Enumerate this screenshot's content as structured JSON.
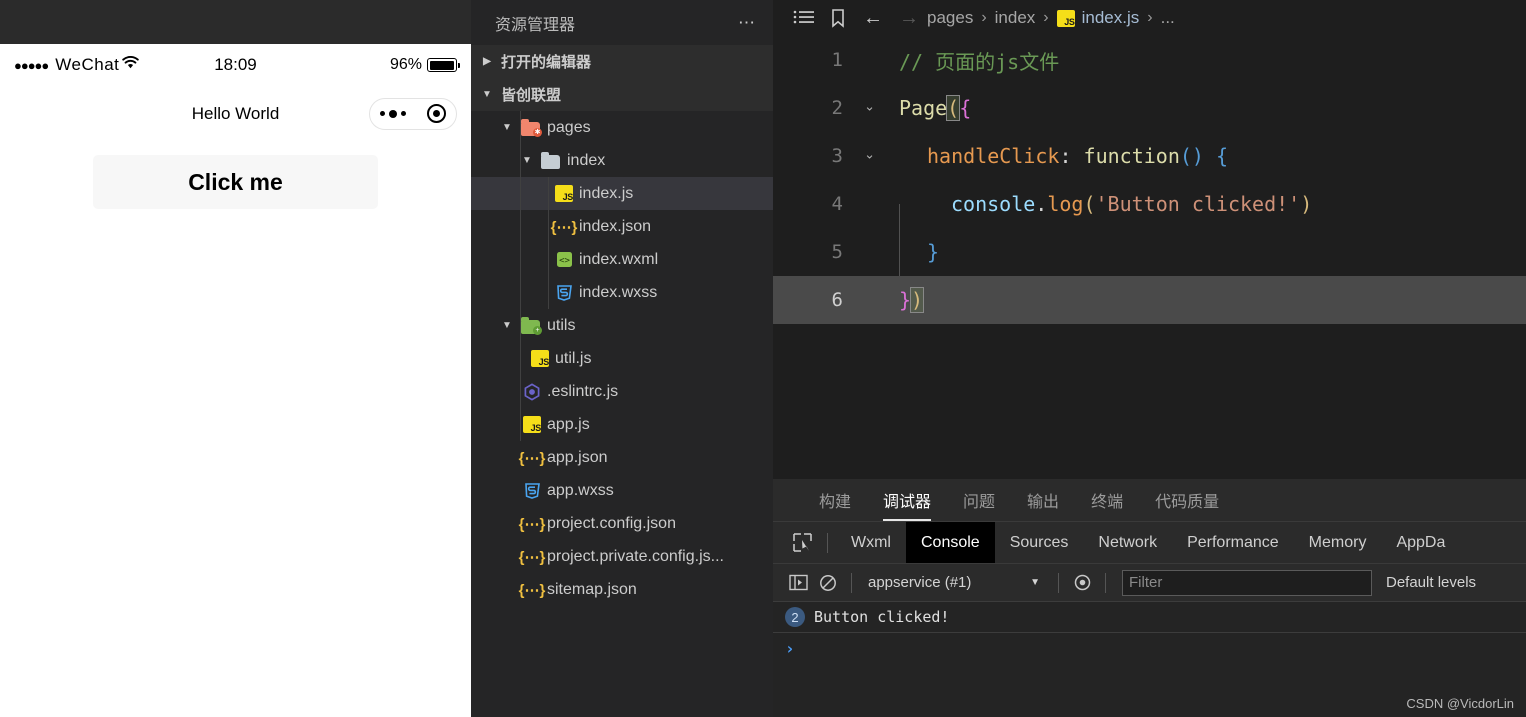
{
  "simulator": {
    "status_bar": {
      "signal_dots": "●●●●●",
      "carrier": "WeChat",
      "wifi_icon": "wifi-icon",
      "time": "18:09",
      "battery_percent": "96%"
    },
    "nav": {
      "title": "Hello World",
      "capsule_more_icon": "more-dots-icon",
      "capsule_target_icon": "target-icon"
    },
    "button_label": "Click me"
  },
  "explorer": {
    "title": "资源管理器",
    "more_icon": "more-actions-icon",
    "sections": [
      {
        "label": "打开的编辑器",
        "expanded": false
      },
      {
        "label": "皆创联盟",
        "expanded": true
      }
    ],
    "tree": [
      {
        "label": "pages",
        "type": "folder",
        "icon": "folder-pages-icon",
        "depth": 1,
        "expanded": true,
        "selected": false
      },
      {
        "label": "index",
        "type": "folder",
        "icon": "folder-plain-icon",
        "depth": 2,
        "expanded": true,
        "selected": false
      },
      {
        "label": "index.js",
        "type": "js",
        "icon": "js-file-icon",
        "depth": 3,
        "selected": true
      },
      {
        "label": "index.json",
        "type": "json",
        "icon": "json-file-icon",
        "depth": 3,
        "selected": false
      },
      {
        "label": "index.wxml",
        "type": "wxml",
        "icon": "wxml-file-icon",
        "depth": 3,
        "selected": false
      },
      {
        "label": "index.wxss",
        "type": "wxss",
        "icon": "wxss-file-icon",
        "depth": 3,
        "selected": false
      },
      {
        "label": "utils",
        "type": "folder",
        "icon": "folder-utils-icon",
        "depth": 1,
        "expanded": true,
        "selected": false
      },
      {
        "label": "util.js",
        "type": "js",
        "icon": "js-file-icon",
        "depth": 2,
        "selected": false
      },
      {
        "label": ".eslintrc.js",
        "type": "eslint",
        "icon": "eslint-file-icon",
        "depth": 1,
        "selected": false
      },
      {
        "label": "app.js",
        "type": "js",
        "icon": "js-file-icon",
        "depth": 1,
        "selected": false
      },
      {
        "label": "app.json",
        "type": "json",
        "icon": "json-file-icon",
        "depth": 1,
        "selected": false
      },
      {
        "label": "app.wxss",
        "type": "wxss",
        "icon": "wxss-file-icon",
        "depth": 1,
        "selected": false
      },
      {
        "label": "project.config.json",
        "type": "json",
        "icon": "json-file-icon",
        "depth": 1,
        "selected": false
      },
      {
        "label": "project.private.config.js...",
        "type": "json",
        "icon": "json-file-icon",
        "depth": 1,
        "selected": false
      },
      {
        "label": "sitemap.json",
        "type": "json",
        "icon": "json-file-icon",
        "depth": 1,
        "selected": false
      }
    ]
  },
  "breadcrumb": {
    "outline_icon": "outline-list-icon",
    "bookmark_icon": "bookmark-icon",
    "back_icon": "arrow-left-icon",
    "forward_icon": "arrow-right-icon",
    "items": [
      "pages",
      "index",
      "index.js",
      "..."
    ],
    "file_icon": "js-file-icon",
    "separator": "›"
  },
  "code": {
    "lines": [
      {
        "num": "1",
        "fold": "",
        "active": false
      },
      {
        "num": "2",
        "fold": "⌄",
        "active": false
      },
      {
        "num": "3",
        "fold": "⌄",
        "active": false
      },
      {
        "num": "4",
        "fold": "",
        "active": false
      },
      {
        "num": "5",
        "fold": "",
        "active": false
      },
      {
        "num": "6",
        "fold": "",
        "active": true
      }
    ],
    "tokens": {
      "l1_comment": "// 页面的js文件",
      "l2_page": "Page",
      "l2_paren": "(",
      "l2_brace": "{",
      "l3_prop": "handleClick",
      "l3_colon": ": ",
      "l3_function": "function",
      "l3_parens": "()",
      "l3_space": " ",
      "l3_brace": "{",
      "l4_console": "console",
      "l4_dot": ".",
      "l4_log": "log",
      "l4_open": "(",
      "l4_string": "'Button clicked!'",
      "l4_close": ")",
      "l5_brace": "}",
      "l6_brace": "}",
      "l6_paren": ")"
    }
  },
  "panel": {
    "tabs": [
      {
        "label": "构建",
        "active": false
      },
      {
        "label": "调试器",
        "active": true
      },
      {
        "label": "问题",
        "active": false
      },
      {
        "label": "输出",
        "active": false
      },
      {
        "label": "终端",
        "active": false
      },
      {
        "label": "代码质量",
        "active": false
      }
    ],
    "devtools_tabs": [
      {
        "label": "Wxml",
        "active": false
      },
      {
        "label": "Console",
        "active": true
      },
      {
        "label": "Sources",
        "active": false
      },
      {
        "label": "Network",
        "active": false
      },
      {
        "label": "Performance",
        "active": false
      },
      {
        "label": "Memory",
        "active": false
      },
      {
        "label": "AppDa",
        "active": false
      }
    ],
    "inspect_icon": "inspect-element-icon",
    "console_toolbar": {
      "sidebar_icon": "console-sidebar-icon",
      "clear_icon": "clear-console-icon",
      "context": "appservice (#1)",
      "caret_icon": "chevron-down-icon",
      "eye_icon": "eye-icon",
      "filter_placeholder": "Filter",
      "filter_value": "",
      "levels": "Default levels"
    },
    "console_messages": [
      {
        "count": "2",
        "text": "Button clicked!"
      }
    ],
    "prompt": "›"
  },
  "watermark": "CSDN @VicdorLin",
  "colors": {
    "editor_bg": "#1e1e1e",
    "sidebar_bg": "#252526",
    "selection": "#37373d",
    "js_yellow": "#f5de19",
    "comment_green": "#6a9955",
    "string_orange": "#ce9178",
    "accent_blue": "#4a9df8"
  }
}
